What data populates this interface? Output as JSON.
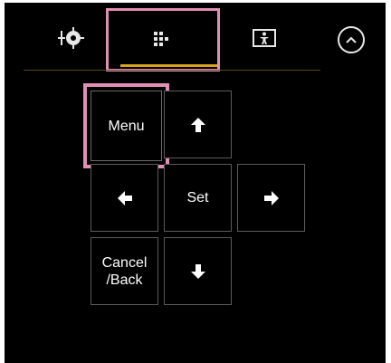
{
  "tabs": [
    {
      "id": "camera",
      "icon": "target-icon",
      "active": false
    },
    {
      "id": "menu-control",
      "icon": "grid-dots-icon",
      "active": true
    },
    {
      "id": "person-frame",
      "icon": "person-frame-icon",
      "active": false
    }
  ],
  "collapse_icon": "chevron-up-icon",
  "keypad": {
    "menu_label": "Menu",
    "set_label": "Set",
    "cancel_label": "Cancel\n/Back"
  },
  "colors": {
    "focus_outline": "#e28fb5",
    "active_tab_underline": "#d8a420",
    "panel_background": "#000000",
    "key_border": "#5b5b5b"
  }
}
